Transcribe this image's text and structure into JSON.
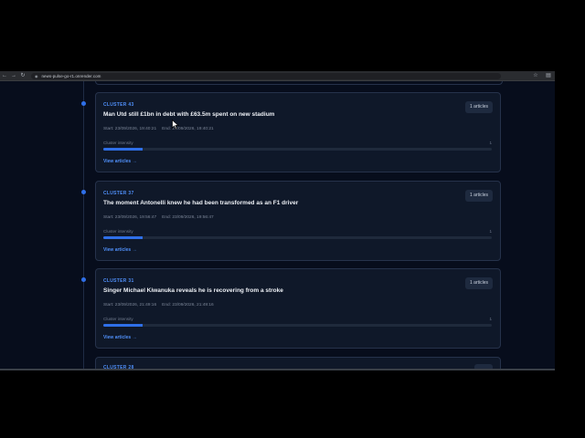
{
  "browser": {
    "url": "news-pulse-go-r1.onrender.com"
  },
  "icons": {
    "back": "back-arrow-icon",
    "forward": "forward-arrow-icon",
    "reload": "reload-icon",
    "star": "star-icon",
    "menu": "menu-icon"
  },
  "clusters": [
    {
      "id_label": "CLUSTER 43",
      "title": "Man Utd still £1bn in debt with £63.5m spent on new stadium",
      "start": "Start: 23/09/2026, 19:40:21",
      "end": "End: 23/09/2026, 19:40:21",
      "badge": "1 articles",
      "intensity_label": "Cluster intensity",
      "intensity_value": "1",
      "intensity_fraction": 0.1,
      "link": "View articles →"
    },
    {
      "id_label": "CLUSTER 37",
      "title": "The moment Antonelli knew he had been transformed as an F1 driver",
      "start": "Start: 23/09/2026, 19:56:47",
      "end": "End: 23/09/2026, 19:56:47",
      "badge": "1 articles",
      "intensity_label": "Cluster intensity",
      "intensity_value": "1",
      "intensity_fraction": 0.1,
      "link": "View articles →"
    },
    {
      "id_label": "CLUSTER 31",
      "title": "Singer Michael Kiwanuka reveals he is recovering from a stroke",
      "start": "Start: 23/09/2026, 21:49:16",
      "end": "End: 23/09/2026, 21:49:16",
      "badge": "1 articles",
      "intensity_label": "Cluster intensity",
      "intensity_value": "1",
      "intensity_fraction": 0.1,
      "link": "View articles →"
    },
    {
      "id_label": "CLUSTER 28"
    }
  ],
  "colors": {
    "accent": "#2f6fe8",
    "background": "#070d1c",
    "card": "#0f1829"
  }
}
